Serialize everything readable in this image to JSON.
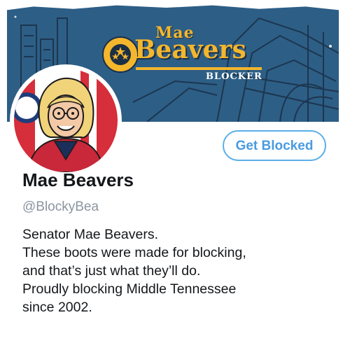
{
  "banner": {
    "logo_top": "Mae",
    "logo_main": "Beavers",
    "logo_sub": "BLOCKER",
    "colors": {
      "background": "#2d5e86",
      "logo": "#f4b62c",
      "accent_line": "#1b2f46"
    }
  },
  "profile": {
    "avatar_icon": "avatar-portrait",
    "display_name": "Mae Beavers",
    "handle": "@BlockyBea",
    "bio_lines": [
      "Senator Mae Beavers.",
      "These boots were made for blocking,",
      "and that’s just what they’ll do.",
      "Proudly blocking Middle Tennessee",
      "since 2002."
    ]
  },
  "actions": {
    "follow_label": "Get Blocked",
    "accent": "#4a9be0"
  }
}
